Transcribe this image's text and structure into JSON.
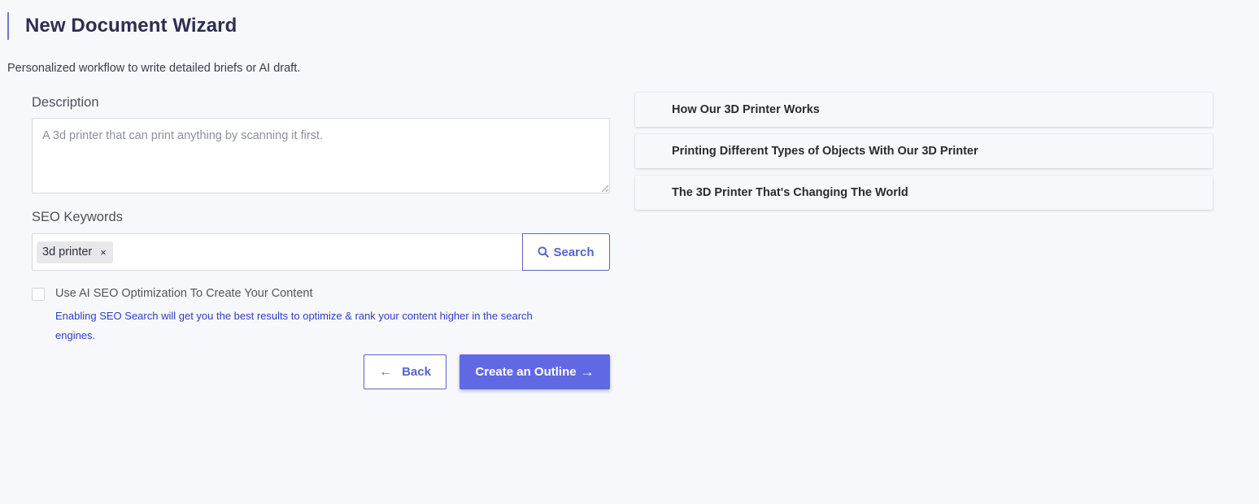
{
  "header": {
    "title": "New Document Wizard",
    "subtitle": "Personalized workflow to write detailed briefs or AI draft."
  },
  "form": {
    "description_label": "Description",
    "description_placeholder": "A 3d printer that can print anything by scanning it first.",
    "seo_label": "SEO Keywords",
    "keywords": [
      {
        "text": "3d printer",
        "remove_glyph": "×"
      }
    ],
    "search_label": "Search",
    "search_icon": "search-icon",
    "ai_checkbox_checked": false,
    "ai_checkbox_label": "Use AI SEO Optimization To Create Your Content",
    "ai_help_text": "Enabling SEO Search will get you the best results to optimize & rank your content higher in the search engines."
  },
  "actions": {
    "back_label": "Back",
    "back_arrow": "←",
    "create_label": "Create an Outline",
    "create_arrow": "→"
  },
  "outline": {
    "items": [
      {
        "title": "How Our 3D Printer Works"
      },
      {
        "title": "Printing Different Types of Objects With Our 3D Printer"
      },
      {
        "title": "The 3D Printer That's Changing The World"
      }
    ]
  },
  "colors": {
    "accent": "#6069e3",
    "accent_border": "#5a65c9",
    "help_text": "#2c3fc2",
    "background": "#f7f8fc"
  }
}
